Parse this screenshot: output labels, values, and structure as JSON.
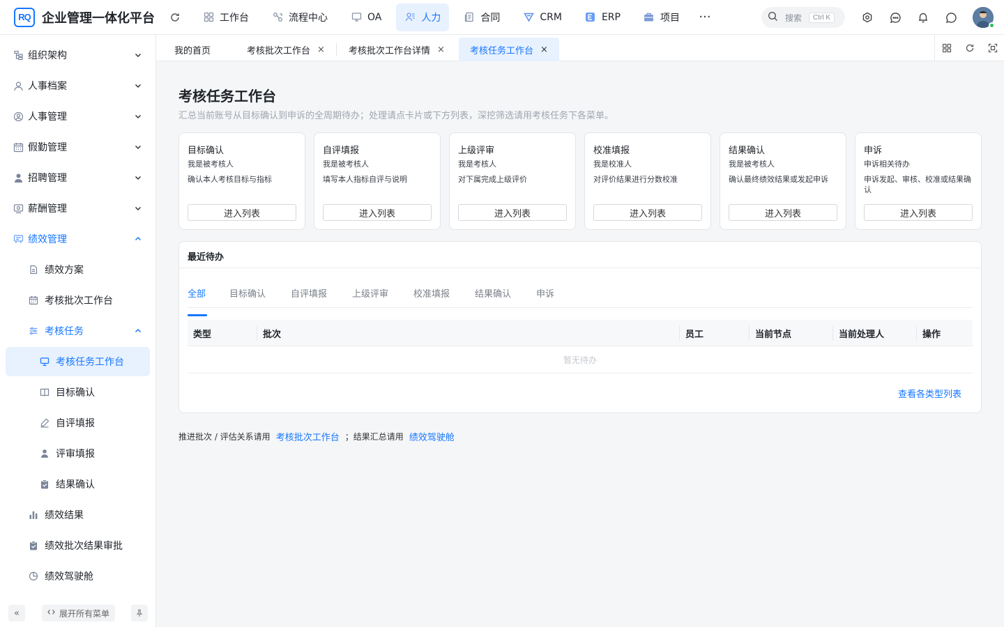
{
  "app": {
    "logo_text": "RQ",
    "title": "企业管理一体化平台"
  },
  "nav": {
    "items": [
      {
        "label": "工作台",
        "icon": "grid-icon"
      },
      {
        "label": "流程中心",
        "icon": "flow-icon"
      },
      {
        "label": "OA",
        "icon": "monitor-icon"
      },
      {
        "label": "人力",
        "icon": "people-icon"
      },
      {
        "label": "合同",
        "icon": "document-icon"
      },
      {
        "label": "CRM",
        "icon": "crm-icon"
      },
      {
        "label": "ERP",
        "icon": "erp-icon"
      },
      {
        "label": "项目",
        "icon": "briefcase-icon"
      }
    ],
    "active": "人力",
    "more": "···"
  },
  "search": {
    "placeholder": "搜索",
    "shortcut": "Ctrl K"
  },
  "sidebar": {
    "items": [
      {
        "label": "组织架构",
        "icon": "org-icon"
      },
      {
        "label": "人事档案",
        "icon": "user-icon"
      },
      {
        "label": "人事管理",
        "icon": "user-circle-icon"
      },
      {
        "label": "假勤管理",
        "icon": "calendar-icon"
      },
      {
        "label": "招聘管理",
        "icon": "person-icon"
      },
      {
        "label": "薪酬管理",
        "icon": "salary-icon"
      },
      {
        "label": "绩效管理",
        "icon": "performance-icon"
      },
      {
        "label": "绩效方案",
        "icon": "file-icon"
      },
      {
        "label": "考核批次工作台",
        "icon": "calendar-icon"
      },
      {
        "label": "考核任务",
        "icon": "sliders-icon"
      },
      {
        "label": "考核任务工作台",
        "icon": "monitor-icon"
      },
      {
        "label": "目标确认",
        "icon": "book-icon"
      },
      {
        "label": "自评填报",
        "icon": "pen-icon"
      },
      {
        "label": "评审填报",
        "icon": "person-icon"
      },
      {
        "label": "结果确认",
        "icon": "clipboard-check-icon"
      },
      {
        "label": "绩效结果",
        "icon": "bar-chart-icon"
      },
      {
        "label": "绩效批次结果审批",
        "icon": "clipboard-check-icon"
      },
      {
        "label": "绩效驾驶舱",
        "icon": "pie-chart-icon"
      }
    ],
    "selected": "考核任务工作台",
    "footer": {
      "collapse": "«",
      "expand_label": "展开所有菜单"
    }
  },
  "tabs": {
    "items": [
      {
        "label": "我的首页",
        "closable": false
      },
      {
        "label": "考核批次工作台",
        "closable": true
      },
      {
        "label": "考核批次工作台详情",
        "closable": true
      },
      {
        "label": "考核任务工作台",
        "closable": true
      }
    ],
    "active": "考核任务工作台",
    "close_glyph": "×"
  },
  "page": {
    "title": "考核任务工作台",
    "description": "汇总当前账号从目标确认到申诉的全周期待办；处理请点卡片或下方列表，深挖筛选请用考核任务下各菜单。"
  },
  "cards": [
    {
      "title": "目标确认",
      "role": "我是被考核人",
      "desc": "确认本人考核目标与指标",
      "button": "进入列表"
    },
    {
      "title": "自评填报",
      "role": "我是被考核人",
      "desc": "填写本人指标自评与说明",
      "button": "进入列表"
    },
    {
      "title": "上级评审",
      "role": "我是考核人",
      "desc": "对下属完成上级评价",
      "button": "进入列表"
    },
    {
      "title": "校准填报",
      "role": "我是校准人",
      "desc": "对评价结果进行分数校准",
      "button": "进入列表"
    },
    {
      "title": "结果确认",
      "role": "我是被考核人",
      "desc": "确认最终绩效结果或发起申诉",
      "button": "进入列表"
    },
    {
      "title": "申诉",
      "role": "申诉相关待办",
      "desc": "申诉发起、审核、校准或结果确认",
      "button": "进入列表"
    }
  ],
  "recent": {
    "title": "最近待办",
    "tabs": [
      "全部",
      "目标确认",
      "自评填报",
      "上级评审",
      "校准填报",
      "结果确认",
      "申诉"
    ],
    "active_tab": "全部",
    "columns": [
      "类型",
      "批次",
      "员工",
      "当前节点",
      "当前处理人",
      "操作"
    ],
    "rows": [],
    "empty_text": "暂无待办",
    "link": "查看各类型列表"
  },
  "footnote": {
    "prefix": "推进批次 / 评估关系请用",
    "link1": "考核批次工作台",
    "middle": "；结果汇总请用",
    "link2": "绩效驾驶舱"
  },
  "colors": {
    "accent": "#1677ff",
    "accent_bg": "#e8f1fe",
    "online_dot": "#2fc25b"
  }
}
